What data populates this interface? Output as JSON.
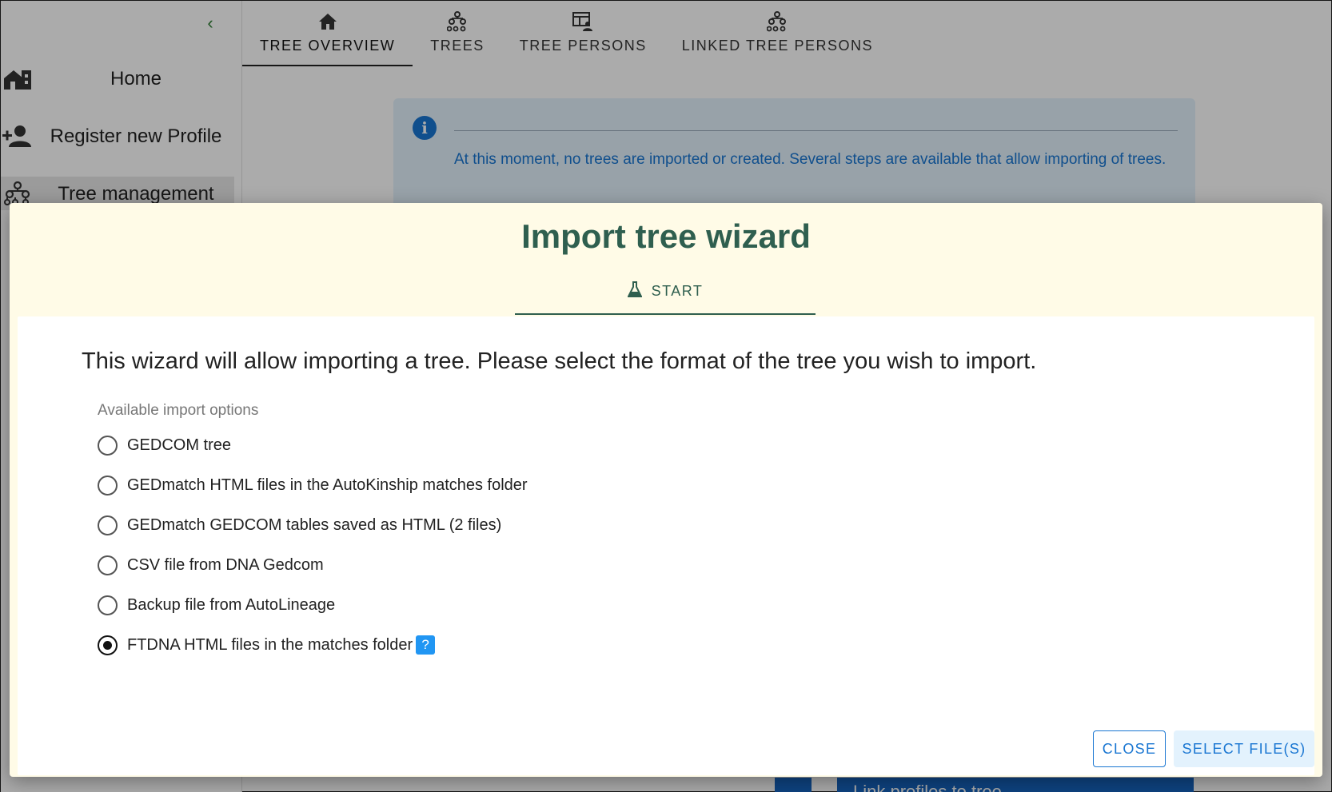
{
  "sidebar": {
    "collapse_icon": "chevron-left-icon",
    "items": [
      {
        "label": "Home",
        "icon": "home-icon"
      },
      {
        "label": "Register new Profile",
        "icon": "person-add-icon"
      },
      {
        "label": "Tree management",
        "icon": "tree-icon",
        "active": true
      }
    ]
  },
  "tabs": [
    {
      "label": "TREE OVERVIEW",
      "icon": "house-icon",
      "active": true
    },
    {
      "label": "TREES",
      "icon": "tree-icon"
    },
    {
      "label": "TREE PERSONS",
      "icon": "table-person-icon"
    },
    {
      "label": "LINKED TREE PERSONS",
      "icon": "tree-icon"
    }
  ],
  "info_alert": {
    "text": "At this moment, no trees are imported or created. Several steps are available that allow importing of trees.",
    "icon": "info-icon"
  },
  "background_button": {
    "label": "Link profiles to tree"
  },
  "dialog": {
    "title": "Import tree wizard",
    "step": {
      "label": "START",
      "icon": "flask-icon"
    },
    "intro": "This wizard will allow importing a tree. Please select the format of the tree you wish to import.",
    "options_label": "Available import options",
    "options": [
      {
        "label": "GEDCOM tree",
        "checked": false
      },
      {
        "label": "GEDmatch HTML files in the AutoKinship matches folder",
        "checked": false
      },
      {
        "label": "GEDmatch GEDCOM tables saved as HTML (2 files)",
        "checked": false
      },
      {
        "label": "CSV file from DNA Gedcom",
        "checked": false
      },
      {
        "label": "Backup file from AutoLineage",
        "checked": false
      },
      {
        "label": "FTDNA HTML files in the matches folder",
        "checked": true,
        "help": "?"
      }
    ],
    "close_label": "CLOSE",
    "select_label": "SELECT FILE(S)"
  },
  "colors": {
    "accent": "#1976d2",
    "title": "#2f5f4f",
    "dialog_bg": "#fffbe7"
  }
}
